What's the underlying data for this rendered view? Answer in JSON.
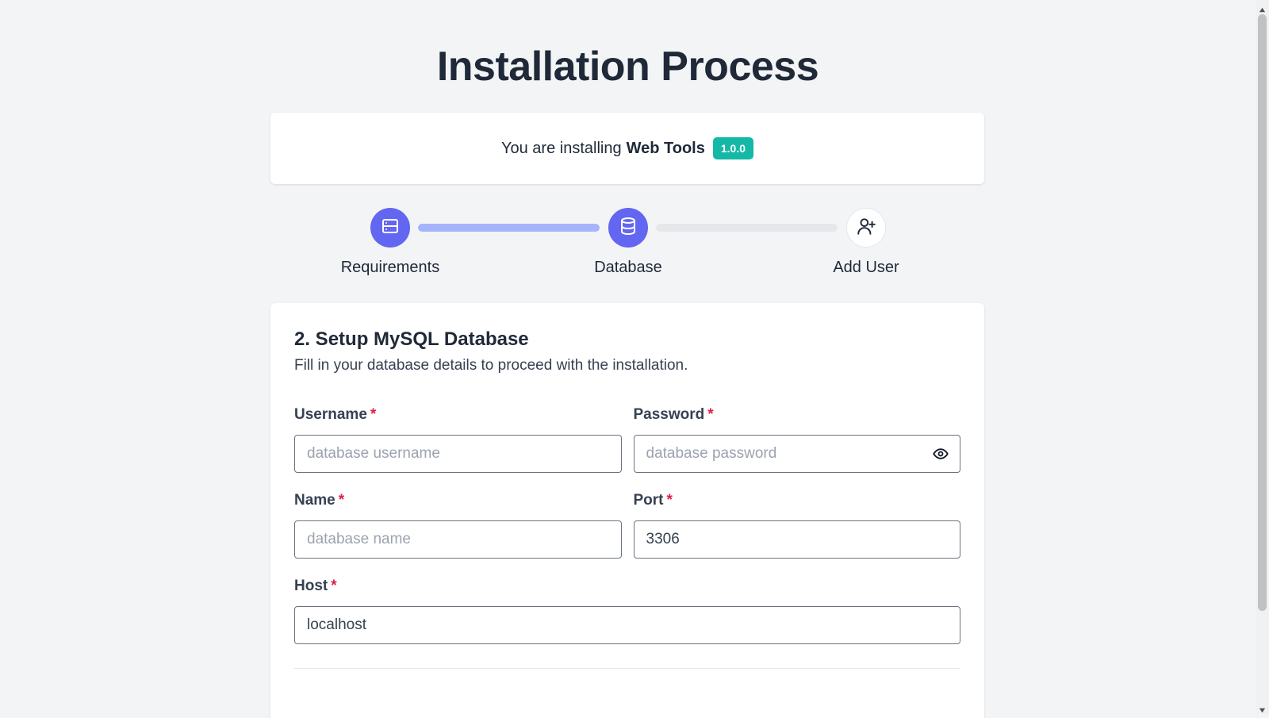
{
  "page": {
    "title": "Installation Process"
  },
  "intro": {
    "prefix": "You are installing",
    "product_name": "Web Tools",
    "version": "1.0.0"
  },
  "steps": [
    {
      "label": "Requirements",
      "icon": "server-icon",
      "state": "done"
    },
    {
      "label": "Database",
      "icon": "database-icon",
      "state": "active"
    },
    {
      "label": "Add User",
      "icon": "user-plus-icon",
      "state": "pending"
    }
  ],
  "form": {
    "title": "2. Setup MySQL Database",
    "subtitle": "Fill in your database details to proceed with the installation.",
    "required_marker": "*",
    "fields": {
      "username": {
        "label": "Username",
        "placeholder": "database username",
        "value": ""
      },
      "password": {
        "label": "Password",
        "placeholder": "database password",
        "value": ""
      },
      "name": {
        "label": "Name",
        "placeholder": "database name",
        "value": ""
      },
      "port": {
        "label": "Port",
        "placeholder": "",
        "value": "3306"
      },
      "host": {
        "label": "Host",
        "placeholder": "",
        "value": "localhost"
      }
    }
  },
  "colors": {
    "accent": "#6366f1",
    "accent_light": "#a5b4fc",
    "badge": "#14b8a6",
    "required": "#e11d48"
  }
}
